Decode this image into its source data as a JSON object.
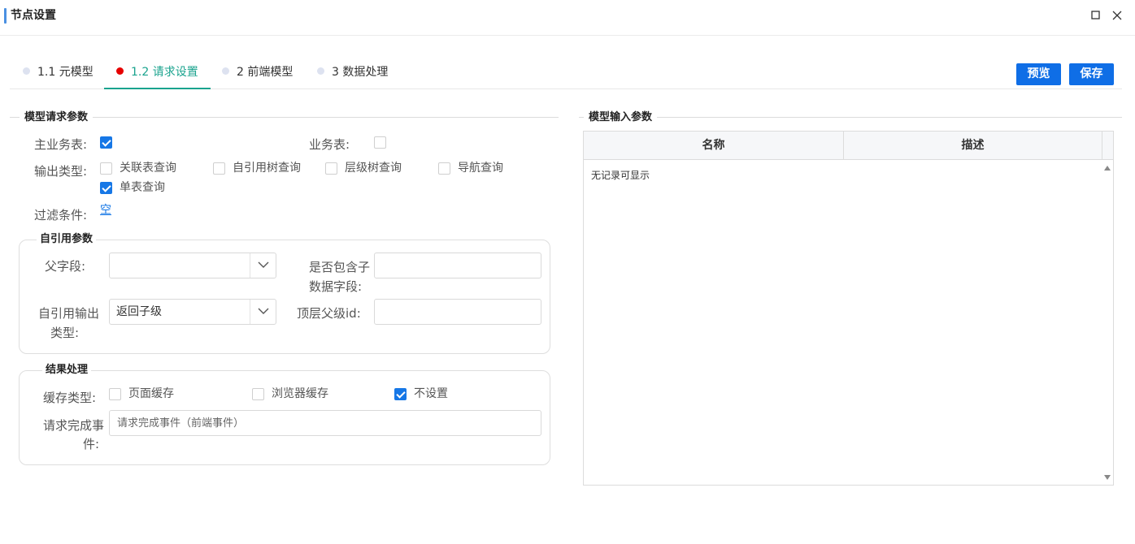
{
  "window": {
    "title": "节点设置"
  },
  "tabs": [
    {
      "label": "1.1 元模型",
      "active": false
    },
    {
      "label": "1.2 请求设置",
      "active": true
    },
    {
      "label": "2 前端模型",
      "active": false
    },
    {
      "label": "3 数据处理",
      "active": false
    }
  ],
  "toolbar": {
    "preview_label": "预览",
    "save_label": "保存"
  },
  "request_params": {
    "title": "模型请求参数",
    "main_table_label": "主业务表:",
    "main_table_checked": true,
    "biz_table_label": "业务表:",
    "biz_table_checked": false,
    "output_type_label": "输出类型:",
    "output_types": [
      {
        "label": "关联表查询",
        "checked": false
      },
      {
        "label": "自引用树查询",
        "checked": false
      },
      {
        "label": "层级树查询",
        "checked": false
      },
      {
        "label": "导航查询",
        "checked": false
      },
      {
        "label": "单表查询",
        "checked": true
      }
    ],
    "filter_label": "过滤条件:",
    "filter_value": "空"
  },
  "self_ref": {
    "title": "自引用参数",
    "parent_field_label": "父字段:",
    "parent_field_value": "",
    "include_children_label_1": "是否包含子",
    "include_children_label_2": "数据字段:",
    "include_children_value": "",
    "output_type_label_1": "自引用输出",
    "output_type_label_2": "类型:",
    "output_type_value": "返回子级",
    "top_parent_label": "顶层父级id:",
    "top_parent_value": ""
  },
  "result": {
    "title": "结果处理",
    "cache_type_label": "缓存类型:",
    "cache_options": [
      {
        "label": "页面缓存",
        "checked": false
      },
      {
        "label": "浏览器缓存",
        "checked": false
      },
      {
        "label": "不设置",
        "checked": true
      }
    ],
    "complete_event_label_1": "请求完成事",
    "complete_event_label_2": "件:",
    "complete_event_placeholder": "请求完成事件（前端事件）"
  },
  "input_params": {
    "title": "模型输入参数",
    "columns": [
      "名称",
      "描述"
    ],
    "empty_text": "无记录可显示"
  },
  "colors": {
    "accent": "#1677e6",
    "tab_active": "#1aa38e",
    "tab_dot_active": "#e60000",
    "button_bg": "#0f6ee6"
  }
}
